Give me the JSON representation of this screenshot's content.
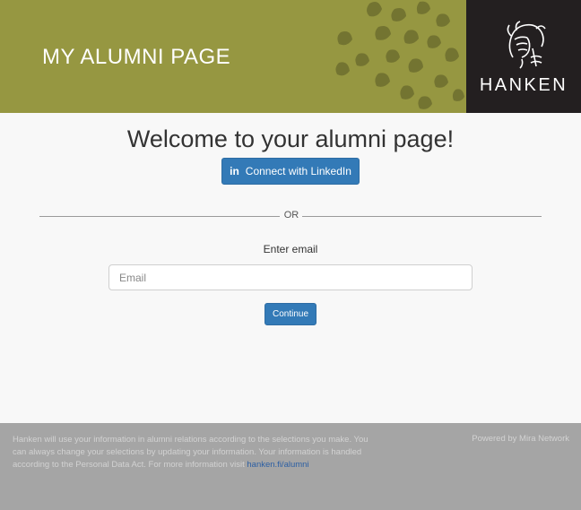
{
  "header": {
    "title": "MY ALUMNI PAGE",
    "logo_text": "HANKEN",
    "bg_color": "#969741",
    "logo_bg_color": "#231f20"
  },
  "main": {
    "heading": "Welcome to your alumni page!",
    "linkedin_button": {
      "icon": "linkedin-icon",
      "icon_glyph": "in",
      "label": "Connect with LinkedIn"
    },
    "or_text": "OR",
    "email_label": "Enter email",
    "email_input": {
      "placeholder": "Email",
      "value": ""
    },
    "continue_label": "Continue",
    "button_color": "#337ab7"
  },
  "footer": {
    "text": "Hanken will use your information in alumni relations according to the selections you make. You can always change your selections by updating your information. Your information is handled according to the Personal Data Act. For more information visit ",
    "link_text": "hanken.fi/alumni",
    "powered_by": "Powered by Mira Network"
  }
}
